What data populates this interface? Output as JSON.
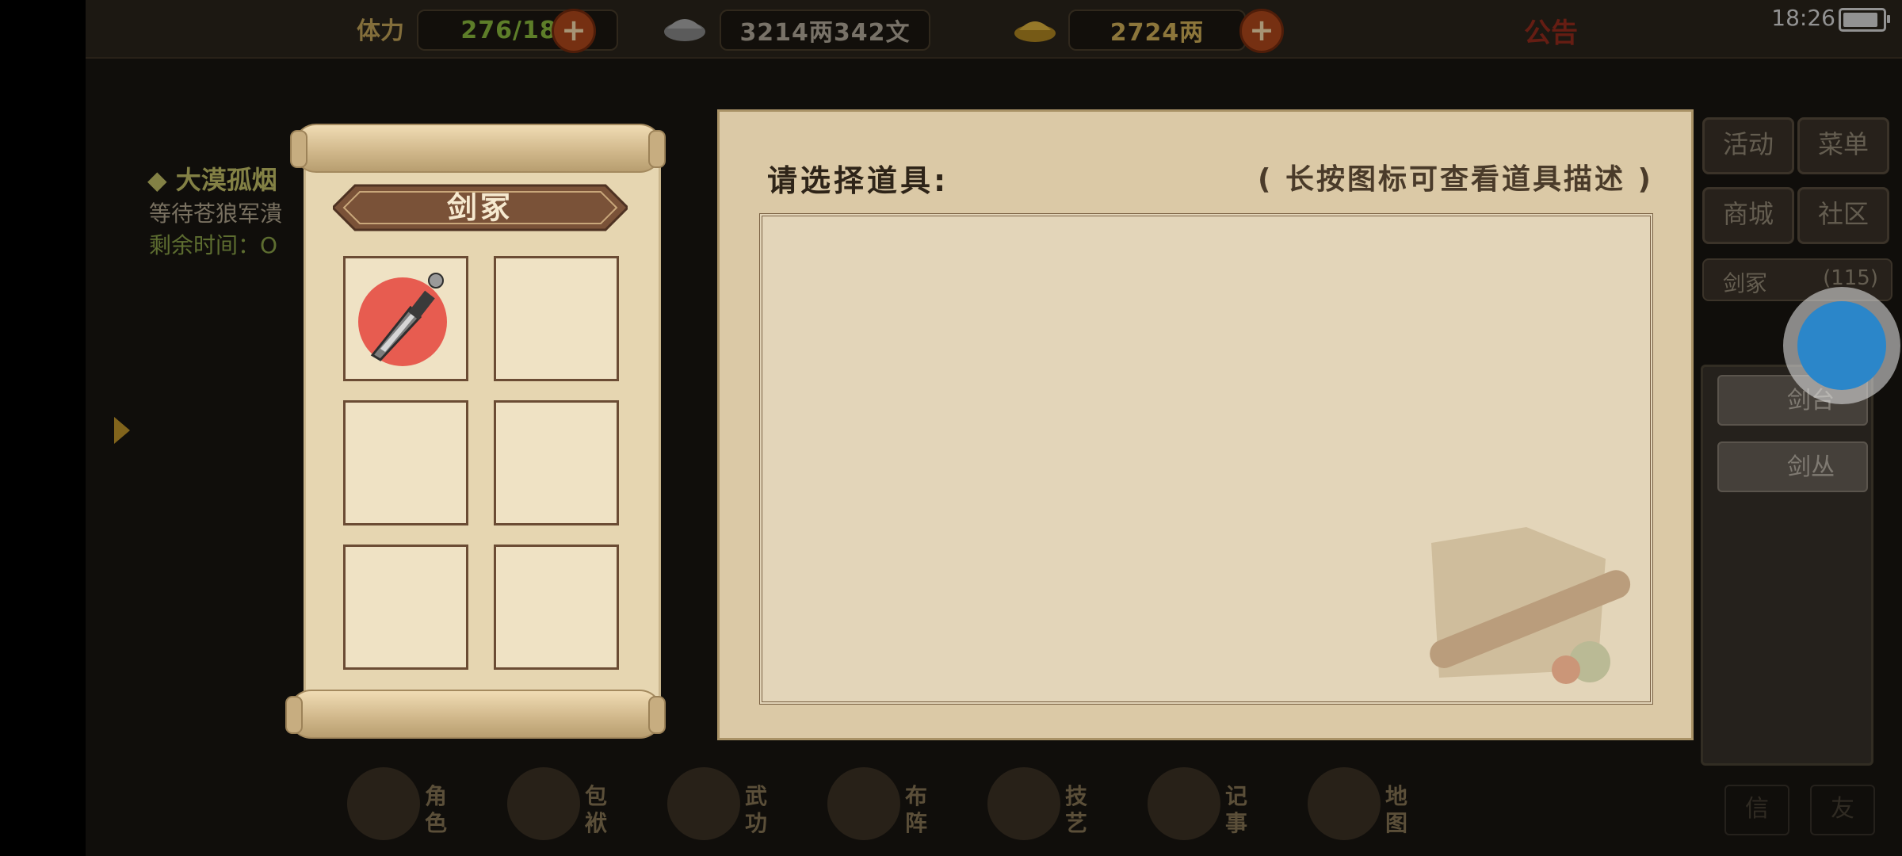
{
  "status_bar": {
    "time": "18:26"
  },
  "top_bar": {
    "stamina_label": "体力",
    "stamina_value": "276/180",
    "silver_value": "3214两342文",
    "gold_value": "2724两",
    "announcement": "公告"
  },
  "quest": {
    "title": "◆ 大漠孤烟",
    "desc": "等待苍狼军潰",
    "time_label": "剩余时间：O"
  },
  "sidebar": {
    "activity": "活动",
    "menu": "菜单",
    "mall": "商城",
    "community": "社区",
    "location_name": "剑冢",
    "location_count": "(115)",
    "sub_place_1": "剑台",
    "sub_place_2": "剑丛"
  },
  "bottom_nav": [
    {
      "label": "角色"
    },
    {
      "label": "包袱"
    },
    {
      "label": "武功"
    },
    {
      "label": "布阵"
    },
    {
      "label": "技艺"
    },
    {
      "label": "记事"
    },
    {
      "label": "地图"
    }
  ],
  "scroll_panel": {
    "title": "剑冢",
    "slots": [
      {
        "item": "dagger",
        "filled": true
      },
      {
        "filled": false
      },
      {
        "filled": false
      },
      {
        "filled": false
      },
      {
        "filled": false
      },
      {
        "filled": false
      }
    ]
  },
  "select_panel": {
    "title": "请选择道具:",
    "hint": "( 长按图标可查看道具描述 )"
  },
  "colors": {
    "parchment": "#dbc9a6",
    "frame_brown": "#6b4c34",
    "stamina_green": "#8fc13f",
    "gold_text": "#d7b55b",
    "plus_red": "#b54a1c"
  }
}
